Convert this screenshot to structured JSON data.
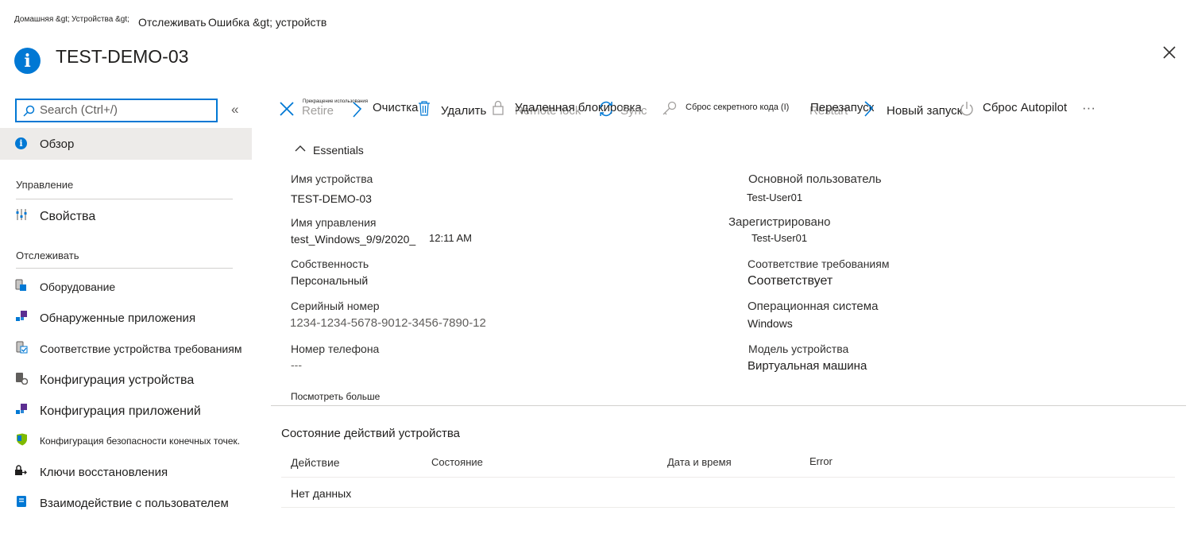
{
  "breadcrumb": {
    "home": "Домашняя &gt;",
    "devices": "Устройства &gt;",
    "monitor": "Отслеживать",
    "error": "Ошибка &gt; устройств"
  },
  "page_title": "TEST-DEMO-03",
  "search": {
    "placeholder": "Search (Ctrl+/)"
  },
  "collapse_label": "«",
  "sidebar": {
    "overview": "Обзор",
    "section_manage": "Управление",
    "properties": "Свойства",
    "section_monitor": "Отслеживать",
    "items": [
      {
        "label": "Оборудование",
        "icon": "hardware-icon"
      },
      {
        "label": "Обнаруженные приложения",
        "icon": "apps-icon"
      },
      {
        "label": "Соответствие устройства требованиям",
        "icon": "compliance-icon"
      },
      {
        "label": "Конфигурация устройства",
        "icon": "device-config-icon"
      },
      {
        "label": "Конфигурация приложений",
        "icon": "app-config-icon"
      },
      {
        "label": "Конфигурация безопасности конечных точек.",
        "icon": "shield-icon"
      },
      {
        "label": "Ключи восстановления",
        "icon": "key-icon"
      },
      {
        "label": "Взаимодействие с пользователем",
        "icon": "user-experience-icon"
      }
    ]
  },
  "toolbar": {
    "retire": "Retire",
    "retire_overlay": "Прекращение использования",
    "wipe": "Очистка",
    "delete": "Удалить",
    "remote_lock_ghost": "Remote lock",
    "remote_lock": "Удаленная блокировка",
    "sync": "Sync",
    "reset_passcode": "Сброс секретного кода (I)",
    "restart_ghost": "Restart",
    "restart": "Перезапуск",
    "fresh_start": "Новый запуск",
    "autopilot_reset": "Сброс Autopilot",
    "more": "···"
  },
  "essentials": {
    "header": "Essentials",
    "fields": {
      "device_name_label": "Имя устройства",
      "device_name_value": "TEST-DEMO-03",
      "management_name_label": "Имя управления",
      "management_name_value": "test_Windows_9/9/2020_",
      "management_name_time": "12:11 AM",
      "ownership_label": "Собственность",
      "ownership_value": "Персональный",
      "serial_label": "Серийный номер",
      "serial_value": "1234-1234-5678-9012-3456-7890-12",
      "phone_label": "Номер телефона",
      "phone_value": "---",
      "primary_user_label": "Основной пользователь",
      "primary_user_value": "Test-User01",
      "enrolled_label": "Зарегистрировано",
      "enrolled_value": "Test-User01",
      "compliance_label": "Соответствие требованиям",
      "compliance_value": "Соответствует",
      "os_label": "Операционная система",
      "os_value": "Windows",
      "model_label": "Модель устройства",
      "model_value": "Виртуальная машина"
    },
    "see_more": "Посмотреть больше"
  },
  "actions_status": {
    "title": "Состояние действий устройства",
    "columns": [
      "Действие",
      "Состояние",
      "Дата и время",
      "Error"
    ],
    "empty": "Нет данных"
  },
  "colors": {
    "accent": "#0078d4",
    "selected_bg": "#edebe9",
    "purple": "#5c2e91"
  }
}
